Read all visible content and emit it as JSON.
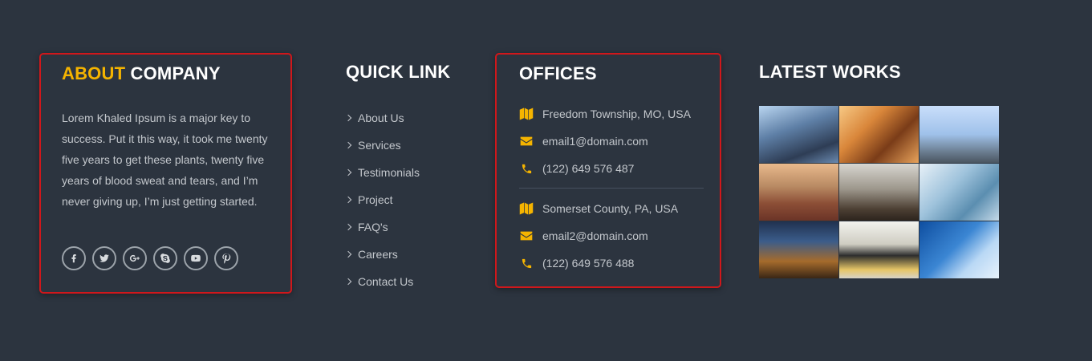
{
  "about": {
    "heading_accent": "ABOUT",
    "heading_rest": "COMPANY",
    "text": "Lorem Khaled Ipsum is a major key to success. Put it this way, it took me twenty five years to get these plants, twenty five years of blood sweat and tears, and I’m never giving up, I’m just getting started.",
    "socials": [
      "facebook-icon",
      "twitter-icon",
      "google-plus-icon",
      "skype-icon",
      "youtube-icon",
      "pinterest-icon"
    ]
  },
  "quick_link": {
    "heading": "QUICK LINK",
    "items": [
      {
        "label": "About Us"
      },
      {
        "label": "Services"
      },
      {
        "label": "Testimonials"
      },
      {
        "label": "Project"
      },
      {
        "label": "FAQ's"
      },
      {
        "label": "Careers"
      },
      {
        "label": "Contact Us"
      }
    ]
  },
  "offices": {
    "heading": "OFFICES",
    "office1": {
      "address": "Freedom Township, MO, USA",
      "email": "email1@domain.com",
      "phone": "(122) 649 576 487"
    },
    "office2": {
      "address": "Somerset County, PA, USA",
      "email": "email2@domain.com",
      "phone": "(122) 649 576 488"
    }
  },
  "latest_works": {
    "heading": "LATEST WORKS",
    "tiles": [
      "glass-building-photo",
      "timber-frame-photo",
      "crane-construction-photo",
      "temple-aerial-photo",
      "meeting-room-photo",
      "glass-tower-photo",
      "night-city-photo",
      "office-building-photo",
      "blue-skyscraper-photo"
    ]
  },
  "colors": {
    "background": "#2c343f",
    "accent": "#f5b400",
    "highlight_border": "#d0171b"
  }
}
